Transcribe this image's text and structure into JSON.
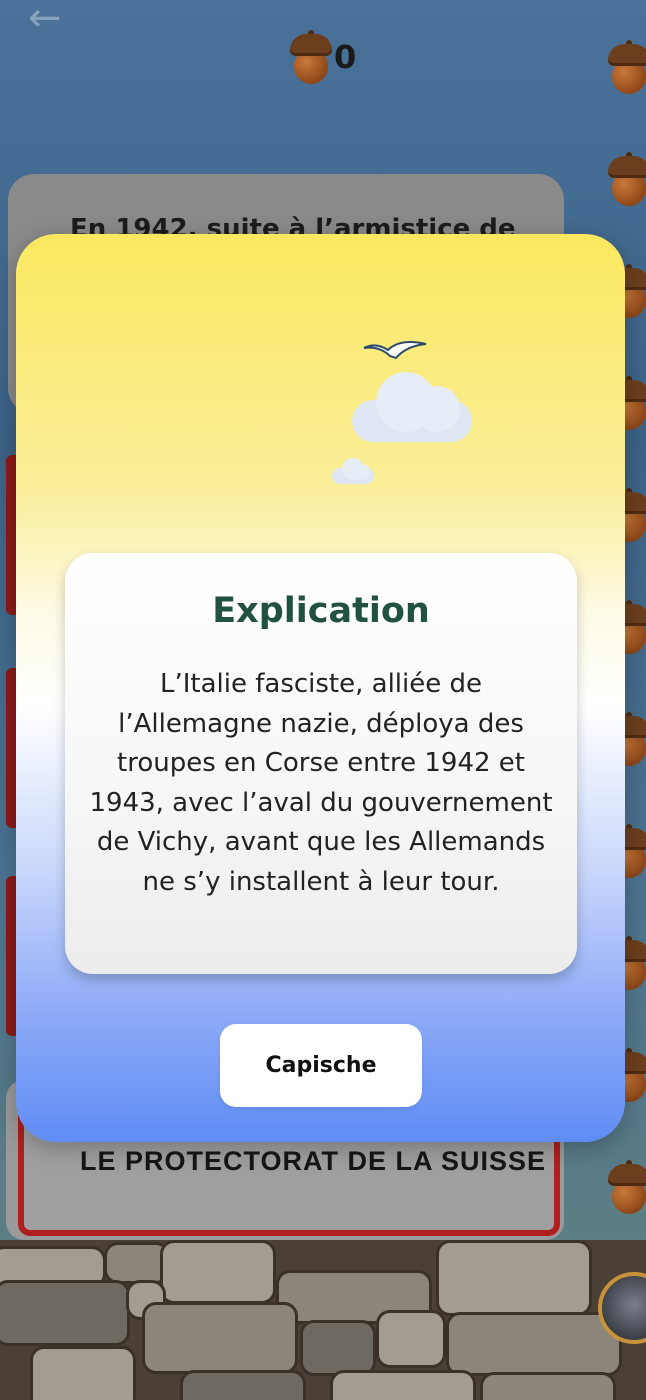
{
  "header": {
    "back_icon": "arrow-left-icon",
    "score": "0",
    "score_icon": "acorn-icon"
  },
  "question": {
    "text": "En 1942, suite à l’armistice de"
  },
  "answer_visible": {
    "label": "LE PROTECTORAT DE LA SUISSE"
  },
  "modal": {
    "title": "Explication",
    "body": "L’Italie fasciste, alliée de l’Allemagne nazie, déploya des troupes en Corse entre 1942 et 1943, avec l’aval du gouvernement de Vichy, avant que les Allemands ne s’y installent à leur tour.",
    "button_label": "Capische",
    "colors": {
      "title": "#20523f",
      "gradient_top": "#fbe85f",
      "gradient_bottom": "#5f8df5"
    }
  }
}
